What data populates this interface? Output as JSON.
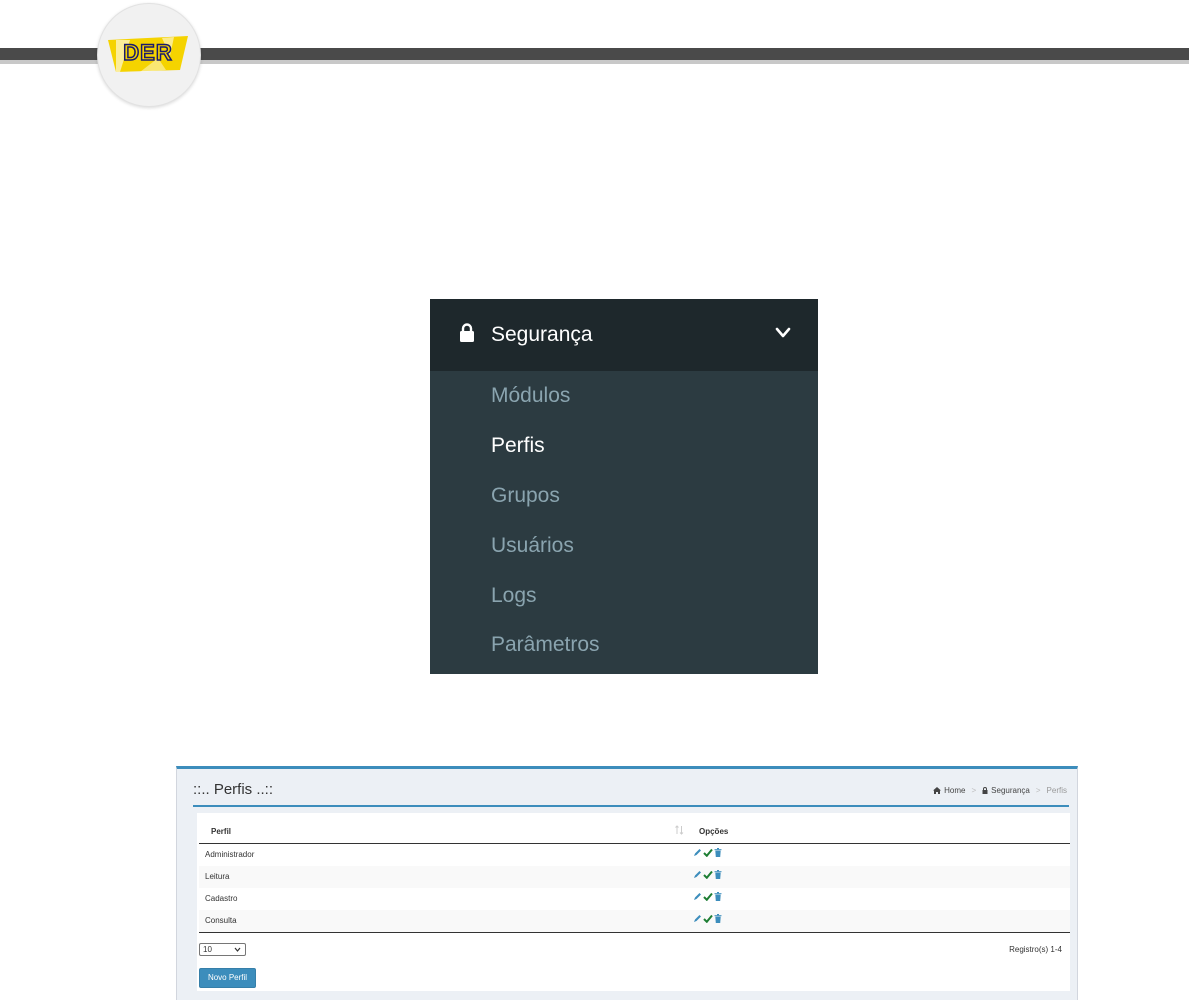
{
  "logo": {
    "text": "DER",
    "color": "#f5d300",
    "outline_color": "#1a1a6e"
  },
  "menu": {
    "title": "Segurança",
    "icon": "lock-icon",
    "expand_icon": "chevron-down-icon",
    "header_bg": "#1e282c",
    "panel_bg": "#2c3b41",
    "items": [
      {
        "label": "Módulos",
        "active": false
      },
      {
        "label": "Perfis",
        "active": true
      },
      {
        "label": "Grupos",
        "active": false
      },
      {
        "label": "Usuários",
        "active": false
      },
      {
        "label": "Logs",
        "active": false
      },
      {
        "label": "Parâmetros",
        "active": false
      }
    ]
  },
  "page": {
    "title": "::.. Perfis ..::",
    "breadcrumb": {
      "home": "Home",
      "section": "Segurança",
      "current": "Perfis",
      "home_icon": "home-icon",
      "section_icon": "lock-icon"
    },
    "table": {
      "columns": [
        "Perfil",
        "Opções"
      ],
      "rows": [
        "Administrador",
        "Leitura",
        "Cadastro",
        "Consulta"
      ],
      "row_actions": [
        "edit-icon",
        "check-icon",
        "trash-icon"
      ]
    },
    "page_size": "10",
    "records": "Registro(s) 1-4",
    "new_button": "Novo Perfil",
    "accent": "#3c8dbc"
  }
}
